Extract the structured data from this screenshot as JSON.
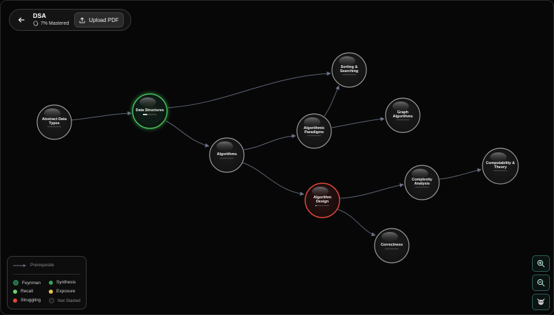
{
  "header": {
    "title": "DSA",
    "mastery_text": "7% Mastered",
    "upload_label": "Upload PDF"
  },
  "nodes": {
    "adt": {
      "line1": "Abstract Data",
      "line2": "Types",
      "status": "not-started"
    },
    "ds": {
      "line1": "Data Structures",
      "status": "synthesis",
      "progress": 0.3
    },
    "alg": {
      "line1": "Algorithms",
      "status": "not-started"
    },
    "par": {
      "line1": "Algorithmic",
      "line2": "Paradigms",
      "status": "not-started"
    },
    "sort": {
      "line1": "Sorting &",
      "line2": "Searching",
      "status": "not-started"
    },
    "graph": {
      "line1": "Graph",
      "line2": "Algorithms",
      "status": "not-started"
    },
    "design": {
      "line1": "Algorithm",
      "line2": "Design",
      "status": "struggling",
      "progress": 0.05
    },
    "complex": {
      "line1": "Complexity",
      "line2": "Analysis",
      "status": "not-started"
    },
    "comp": {
      "line1": "Computability &",
      "line2": "Theory",
      "status": "not-started"
    },
    "correct": {
      "line1": "Correctness",
      "status": "not-started"
    }
  },
  "legend": {
    "prerequisite": "Prerequisite",
    "items": [
      {
        "label": "Feynman",
        "color": "#1f6b43"
      },
      {
        "label": "Synthesis",
        "color": "#3aa35c"
      },
      {
        "label": "Recall",
        "color": "#6ccf72"
      },
      {
        "label": "Exposure",
        "color": "#e3c44a"
      },
      {
        "label": "Struggling",
        "color": "#e2483c"
      },
      {
        "label": "Not Started",
        "color": "#2e2e2e"
      }
    ]
  },
  "colors": {
    "synthesis_ring": "#45c05d",
    "struggling_ring": "#e2483c",
    "default_ring": "#9c9c9c",
    "edge": "#5d6677",
    "control_border": "#2e5f58"
  }
}
